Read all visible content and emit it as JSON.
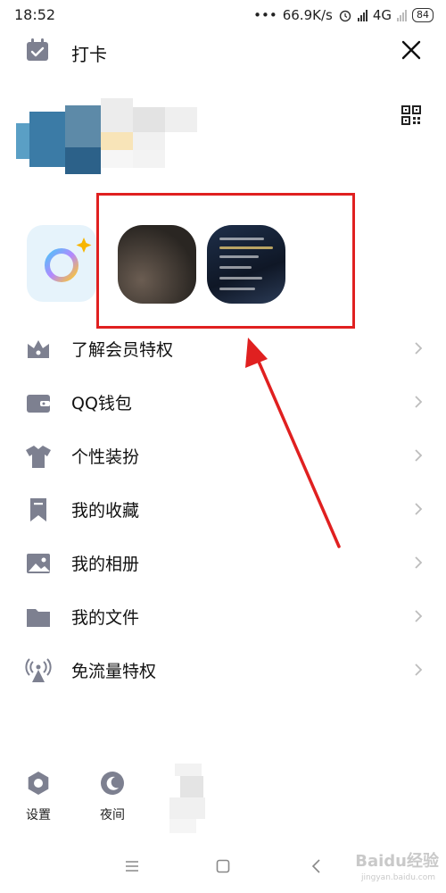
{
  "status": {
    "time": "18:52",
    "dots": "•••",
    "speed": "66.9K/s",
    "network": "4G",
    "battery": "84"
  },
  "header": {
    "title": "打卡"
  },
  "menu": {
    "items": [
      {
        "label": "了解会员特权",
        "icon": "crown-icon"
      },
      {
        "label": "QQ钱包",
        "icon": "wallet-icon"
      },
      {
        "label": "个性装扮",
        "icon": "shirt-icon"
      },
      {
        "label": "我的收藏",
        "icon": "bookmark-icon"
      },
      {
        "label": "我的相册",
        "icon": "image-icon"
      },
      {
        "label": "我的文件",
        "icon": "folder-icon"
      },
      {
        "label": "免流量特权",
        "icon": "antenna-icon"
      }
    ]
  },
  "bottom": {
    "settings_label": "设置",
    "night_label": "夜间"
  },
  "watermark": {
    "brand": "Baidu经验",
    "url": "jingyan.baidu.com"
  },
  "colors": {
    "icon_gray": "#7d8090",
    "highlight_red": "#e02020",
    "chevron": "#bdbdbd"
  }
}
